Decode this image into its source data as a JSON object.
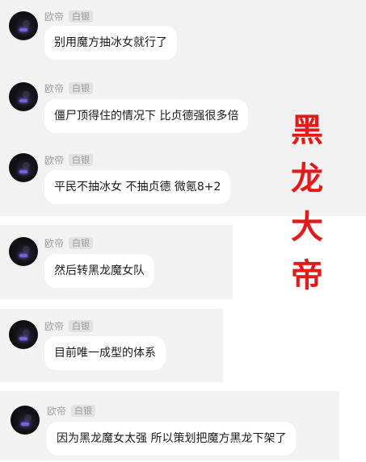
{
  "messages": [
    {
      "user": "欧帝",
      "badge": "白银",
      "text": "别用魔方抽冰女就行了"
    },
    {
      "user": "欧帝",
      "badge": "白银",
      "text": "僵尸顶得住的情况下 比贞德强很多倍"
    },
    {
      "user": "欧帝",
      "badge": "白银",
      "text": "平民不抽冰女 不抽贞德 微氪8+2"
    },
    {
      "user": "欧帝",
      "badge": "白银",
      "text": "然后转黑龙魔女队"
    },
    {
      "user": "欧帝",
      "badge": "白银",
      "text": "目前唯一成型的体系"
    },
    {
      "user": "欧帝",
      "badge": "白银",
      "text": "因为黑龙魔女太强 所以策划把魔方黑龙下架了"
    }
  ],
  "overlay": {
    "chars": [
      "黑",
      "龙",
      "大",
      "帝"
    ],
    "color": "#e41a1a"
  }
}
